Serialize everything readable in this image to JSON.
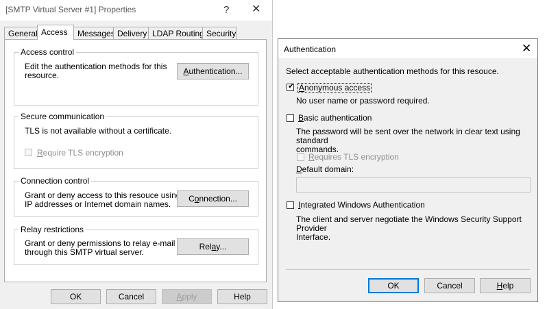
{
  "props_window": {
    "title": "[SMTP Virtual Server #1] Properties",
    "help_glyph": "?",
    "close_glyph": "✕",
    "tabs": [
      "General",
      "Access",
      "Messages",
      "Delivery",
      "LDAP Routing",
      "Security"
    ],
    "active_tab": "Access",
    "access_control": {
      "label": "Access control",
      "text_line1": "Edit the authentication methods for this",
      "text_line2": "resource.",
      "button_pre": "",
      "button_u": "A",
      "button_post": "uthentication..."
    },
    "secure_communication": {
      "label": "Secure communication",
      "text": "TLS is not available without a certificate.",
      "checkbox_u": "R",
      "checkbox_rest": "equire TLS encryption"
    },
    "connection_control": {
      "label": "Connection control",
      "text_line1": "Grant or deny access to this resouce using",
      "text_line2": "IP addresses or Internet domain names.",
      "button_pre": "C",
      "button_u": "o",
      "button_post": "nnection..."
    },
    "relay_restrictions": {
      "label": "Relay restrictions",
      "text_line1": "Grant or deny permissions to relay e-mail",
      "text_line2": "through this SMTP virtual server.",
      "button_pre": "Rel",
      "button_u": "a",
      "button_post": "y..."
    },
    "footer": {
      "ok": "OK",
      "cancel": "Cancel",
      "apply_u": "A",
      "apply_rest": "pply",
      "help": "Help"
    }
  },
  "auth_dialog": {
    "title": "Authentication",
    "close_glyph": "✕",
    "intro": "Select acceptable authentication methods for this resouce.",
    "anonymous": {
      "checked": true,
      "check_glyph": "✔",
      "label_u": "A",
      "label_rest": "nonymous access",
      "desc": "No user name or password required."
    },
    "basic": {
      "checked": false,
      "label_u": "B",
      "label_rest": "asic authentication",
      "desc_line1": "The password will be sent over the network in clear text using standard",
      "desc_line2": "commands.",
      "tls_u": "R",
      "tls_rest": "equires TLS encryption",
      "domain_u": "D",
      "domain_rest": "efault domain:",
      "domain_value": ""
    },
    "integrated": {
      "checked": false,
      "label_u": "I",
      "label_rest": "ntegrated Windows Authentication",
      "desc_line1": "The client and server negotiate the Windows Security Support Provider",
      "desc_line2": "Interface."
    },
    "footer": {
      "ok": "OK",
      "cancel": "Cancel",
      "help_u": "H",
      "help_rest": "elp"
    }
  }
}
